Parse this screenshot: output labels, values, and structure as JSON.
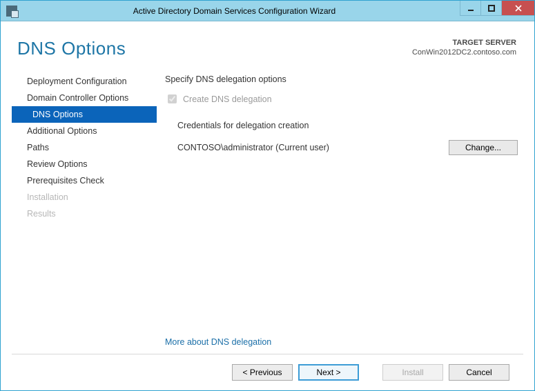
{
  "window": {
    "title": "Active Directory Domain Services Configuration Wizard"
  },
  "header": {
    "page_title": "DNS Options",
    "target_label": "TARGET SERVER",
    "target_value": "ConWin2012DC2.contoso.com"
  },
  "sidebar": {
    "items": [
      {
        "label": "Deployment Configuration",
        "state": "normal"
      },
      {
        "label": "Domain Controller Options",
        "state": "normal"
      },
      {
        "label": "DNS Options",
        "state": "selected"
      },
      {
        "label": "Additional Options",
        "state": "normal"
      },
      {
        "label": "Paths",
        "state": "normal"
      },
      {
        "label": "Review Options",
        "state": "normal"
      },
      {
        "label": "Prerequisites Check",
        "state": "normal"
      },
      {
        "label": "Installation",
        "state": "disabled"
      },
      {
        "label": "Results",
        "state": "disabled"
      }
    ]
  },
  "main": {
    "section_title": "Specify DNS delegation options",
    "checkbox_label": "Create DNS delegation",
    "checkbox_checked": true,
    "checkbox_enabled": false,
    "credentials_heading": "Credentials for delegation creation",
    "credentials_user": "CONTOSO\\administrator (Current user)",
    "change_button": "Change...",
    "more_link": "More about DNS delegation"
  },
  "footer": {
    "previous": "< Previous",
    "next": "Next >",
    "install": "Install",
    "cancel": "Cancel",
    "install_enabled": false
  }
}
